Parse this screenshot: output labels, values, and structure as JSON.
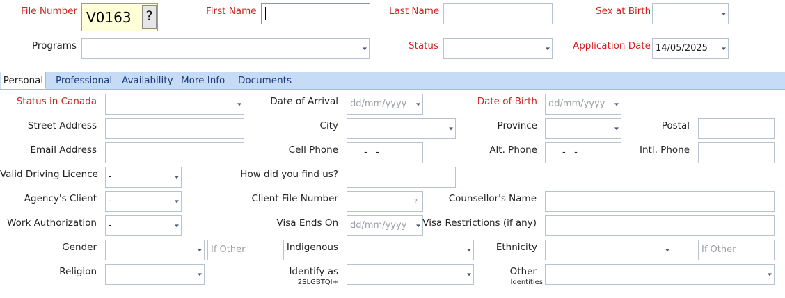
{
  "header": {
    "file_number_label": "File Number",
    "file_number_value": "V0163",
    "lookup_button": "?",
    "first_name_label": "First Name",
    "first_name_value": "",
    "last_name_label": "Last Name",
    "last_name_value": "",
    "sex_label": "Sex at Birth",
    "sex_value": "",
    "programs_label": "Programs",
    "programs_value": "",
    "status_label": "Status",
    "status_value": "",
    "app_date_label": "Application Date",
    "app_date_value": "14/05/2025"
  },
  "tabs": [
    "Personal",
    "Professional",
    "Availability",
    "More Info",
    "Documents"
  ],
  "personal": {
    "status_canada": {
      "label": "Status in Canada",
      "value": ""
    },
    "arrival": {
      "label": "Date of Arrival",
      "placeholder": "dd/mm/yyyy"
    },
    "dob": {
      "label": "Date of Birth",
      "placeholder": "dd/mm/yyyy"
    },
    "street": {
      "label": "Street Address",
      "value": ""
    },
    "city": {
      "label": "City",
      "value": ""
    },
    "province": {
      "label": "Province",
      "value": ""
    },
    "postal": {
      "label": "Postal",
      "value": ""
    },
    "email": {
      "label": "Email Address",
      "value": ""
    },
    "cell": {
      "label": "Cell Phone",
      "mask": "-   -"
    },
    "alt_phone": {
      "label": "Alt. Phone",
      "mask": "-   -"
    },
    "intl_phone": {
      "label": "Intl. Phone",
      "value": ""
    },
    "licence": {
      "label": "Valid Driving Licence",
      "value": "-"
    },
    "find_us": {
      "label": "How did you find us?",
      "value": ""
    },
    "agency": {
      "label": "Agency's Client",
      "value": "-"
    },
    "client_file": {
      "label": "Client File Number",
      "value": "",
      "hint": "?"
    },
    "counsellor": {
      "label": "Counsellor's Name",
      "value": ""
    },
    "work_auth": {
      "label": "Work Authorization",
      "value": "-"
    },
    "visa_ends": {
      "label": "Visa Ends On",
      "placeholder": "dd/mm/yyyy"
    },
    "visa_restr": {
      "label": "Visa Restrictions (if any)",
      "value": ""
    },
    "gender": {
      "label": "Gender",
      "value": "",
      "other_placeholder": "If Other"
    },
    "indigenous": {
      "label": "Indigenous",
      "value": ""
    },
    "ethnicity": {
      "label": "Ethnicity",
      "value": "",
      "other_placeholder": "If Other"
    },
    "religion": {
      "label": "Religion",
      "value": ""
    },
    "identify": {
      "label": "Identify as",
      "sub": "2SLGBTQI+",
      "value": ""
    },
    "other_ident": {
      "label": "Other",
      "sub": "Identities",
      "value": ""
    }
  }
}
